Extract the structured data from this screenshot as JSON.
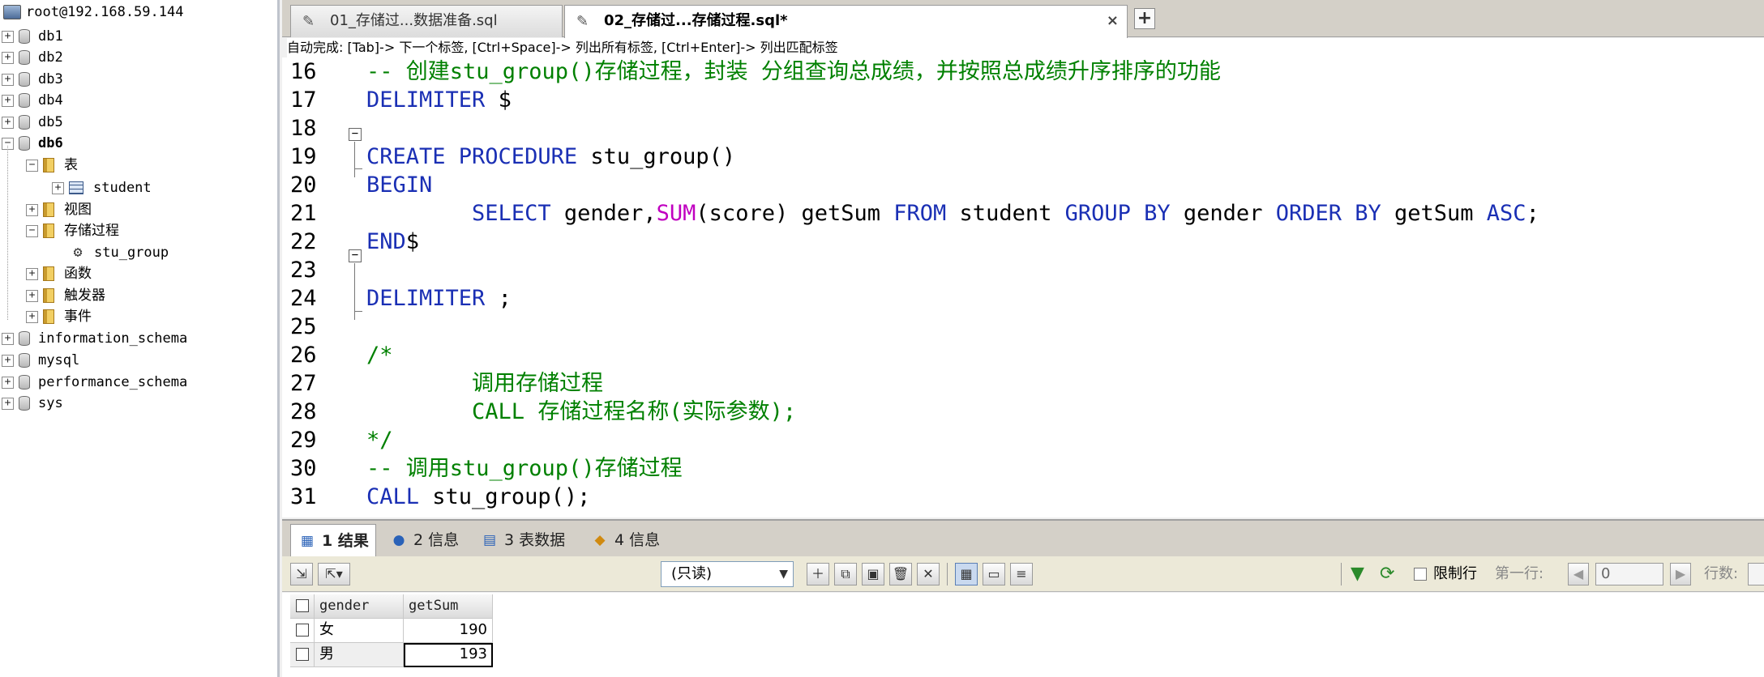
{
  "tree": {
    "server": "root@192.168.59.144",
    "databases": [
      "db1",
      "db2",
      "db3",
      "db4",
      "db5",
      "db6",
      "information_schema",
      "mysql",
      "performance_schema",
      "sys"
    ],
    "db6_children": {
      "tables": "表",
      "table_student": "student",
      "views": "视图",
      "procedures": "存储过程",
      "proc_stu_group": "stu_group",
      "functions": "函数",
      "triggers": "触发器",
      "events": "事件"
    }
  },
  "tabs": [
    {
      "label": "01_存储过...数据准备.sql",
      "active": false
    },
    {
      "label": "02_存储过...存储过程.sql*",
      "active": true
    }
  ],
  "add_tab": "+",
  "tab_close": "×",
  "hint": "自动完成: [Tab]-> 下一个标签, [Ctrl+Space]-> 列出所有标签, [Ctrl+Enter]-> 列出匹配标签",
  "editor": {
    "lines": [
      {
        "n": "16",
        "segs": [
          {
            "t": "-- 创建stu_group()存储过程，封装 分组查询总成绩，并按照总成绩升序排序的功能",
            "c": "cm"
          }
        ]
      },
      {
        "n": "17",
        "segs": [
          {
            "t": "DELIMITER",
            "c": "kw"
          },
          {
            "t": " $",
            "c": "tx"
          }
        ]
      },
      {
        "n": "18",
        "segs": []
      },
      {
        "n": "19",
        "segs": [
          {
            "t": "CREATE PROCEDURE",
            "c": "kw"
          },
          {
            "t": " stu_group()",
            "c": "tx"
          }
        ]
      },
      {
        "n": "20",
        "segs": [
          {
            "t": "BEGIN",
            "c": "kw"
          }
        ]
      },
      {
        "n": "21",
        "segs": [
          {
            "t": "        ",
            "c": "tx"
          },
          {
            "t": "SELECT",
            "c": "kw"
          },
          {
            "t": " gender,",
            "c": "tx"
          },
          {
            "t": "SUM",
            "c": "fn"
          },
          {
            "t": "(score) getSum ",
            "c": "tx"
          },
          {
            "t": "FROM",
            "c": "kw"
          },
          {
            "t": " student ",
            "c": "tx"
          },
          {
            "t": "GROUP BY",
            "c": "kw"
          },
          {
            "t": " gender ",
            "c": "tx"
          },
          {
            "t": "ORDER BY",
            "c": "kw"
          },
          {
            "t": " getSum ",
            "c": "tx"
          },
          {
            "t": "ASC",
            "c": "kw"
          },
          {
            "t": ";",
            "c": "tx"
          }
        ]
      },
      {
        "n": "22",
        "segs": [
          {
            "t": "END",
            "c": "kw"
          },
          {
            "t": "$",
            "c": "tx"
          }
        ]
      },
      {
        "n": "23",
        "segs": []
      },
      {
        "n": "24",
        "segs": [
          {
            "t": "DELIMITER",
            "c": "kw"
          },
          {
            "t": " ;",
            "c": "tx"
          }
        ]
      },
      {
        "n": "25",
        "segs": []
      },
      {
        "n": "26",
        "segs": [
          {
            "t": "/*",
            "c": "cm"
          }
        ]
      },
      {
        "n": "27",
        "segs": [
          {
            "t": "        调用存储过程",
            "c": "cm"
          }
        ]
      },
      {
        "n": "28",
        "segs": [
          {
            "t": "        CALL 存储过程名称(实际参数);",
            "c": "cm"
          }
        ]
      },
      {
        "n": "29",
        "segs": [
          {
            "t": "*/",
            "c": "cm"
          }
        ]
      },
      {
        "n": "30",
        "segs": [
          {
            "t": "-- 调用stu_group()存储过程",
            "c": "cm"
          }
        ]
      },
      {
        "n": "31",
        "segs": [
          {
            "t": "CALL",
            "c": "kw"
          },
          {
            "t": " stu_group();",
            "c": "tx"
          }
        ]
      }
    ]
  },
  "result_tabs": [
    {
      "num": "1",
      "label": "结果",
      "active": true
    },
    {
      "num": "2",
      "label": "信息",
      "active": false
    },
    {
      "num": "3",
      "label": "表数据",
      "active": false
    },
    {
      "num": "4",
      "label": "信息",
      "active": false
    }
  ],
  "toolbar": {
    "readonly": "(只读)",
    "limit_rows": "限制行",
    "first_row": "第一行:",
    "first_row_value": "0",
    "rows": "行数:"
  },
  "grid": {
    "columns": [
      "gender",
      "getSum"
    ],
    "rows": [
      {
        "gender": "女",
        "getSum": "190"
      },
      {
        "gender": "男",
        "getSum": "193"
      }
    ]
  },
  "colors": {
    "keyword": "#1a2fb4",
    "function": "#c000c0",
    "comment": "#008000"
  }
}
